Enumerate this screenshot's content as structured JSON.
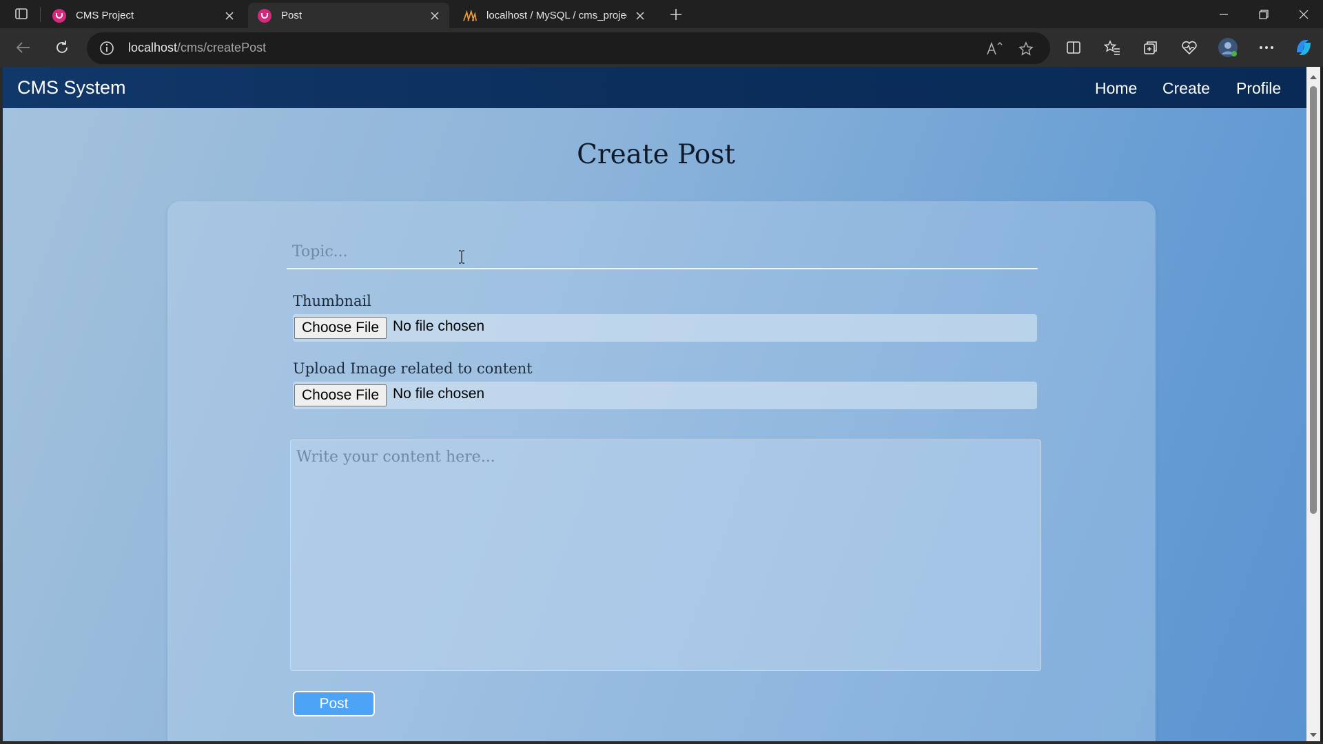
{
  "browser": {
    "tabs": [
      {
        "label": "CMS Project",
        "favicon": "cms-favicon"
      },
      {
        "label": "Post",
        "favicon": "cms-favicon"
      },
      {
        "label": "localhost / MySQL / cms_project",
        "favicon": "phpmyadmin-favicon"
      }
    ],
    "address": {
      "host": "localhost",
      "path": "/cms/createPost"
    }
  },
  "navbar": {
    "brand": "CMS System",
    "links": [
      "Home",
      "Create",
      "Profile"
    ]
  },
  "page": {
    "title": "Create Post",
    "topic_placeholder": "Topic...",
    "thumbnail_label": "Thumbnail",
    "content_image_label": "Upload Image related to content",
    "choose_file": "Choose File",
    "no_file": "No file chosen",
    "content_placeholder": "Write your content here...",
    "post_button": "Post"
  },
  "colors": {
    "navbar": "#0b2e5c",
    "post_button": "#4da3f5",
    "favicon": "#d6287d"
  }
}
